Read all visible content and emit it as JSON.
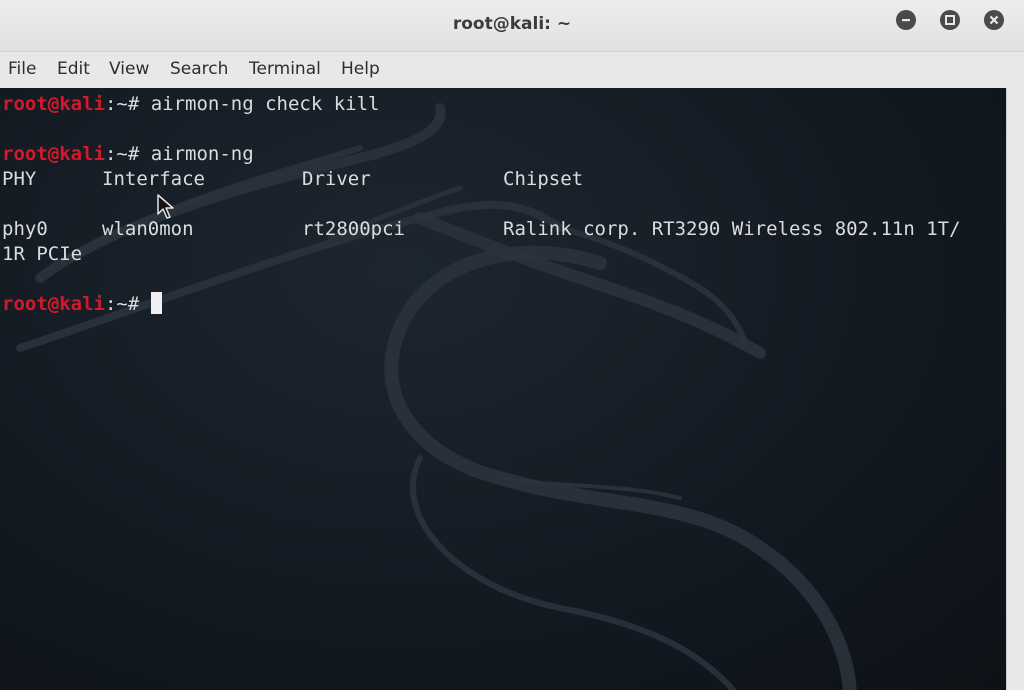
{
  "window": {
    "title": "root@kali: ~"
  },
  "menu": {
    "items": [
      "File",
      "Edit",
      "View",
      "Search",
      "Terminal",
      "Help"
    ]
  },
  "terminal": {
    "prompt_user": "root@kali",
    "prompt_rest": ":~# ",
    "lines": [
      {
        "type": "prompt",
        "command": "airmon-ng check kill"
      },
      {
        "type": "prompt",
        "command": "airmon-ng"
      },
      {
        "type": "header",
        "cols": [
          "PHY",
          "Interface",
          "Driver",
          "Chipset"
        ]
      },
      {
        "type": "row",
        "cols": [
          "phy0",
          "wlan0mon",
          "rt2800pci",
          "Ralink corp. RT3290 Wireless 802.11n 1T/"
        ]
      },
      {
        "type": "wrap",
        "text": "1R PCIe"
      },
      {
        "type": "prompt",
        "command": ""
      }
    ]
  },
  "icons": {
    "minimize": "minimize-icon",
    "maximize": "maximize-icon",
    "close": "close-icon",
    "background": "kali-dragon-logo",
    "pointer": "mouse-pointer-icon"
  },
  "colors": {
    "prompt": "#d3192a",
    "terminal_bg": "#131a22",
    "text": "#dcdcdc"
  }
}
